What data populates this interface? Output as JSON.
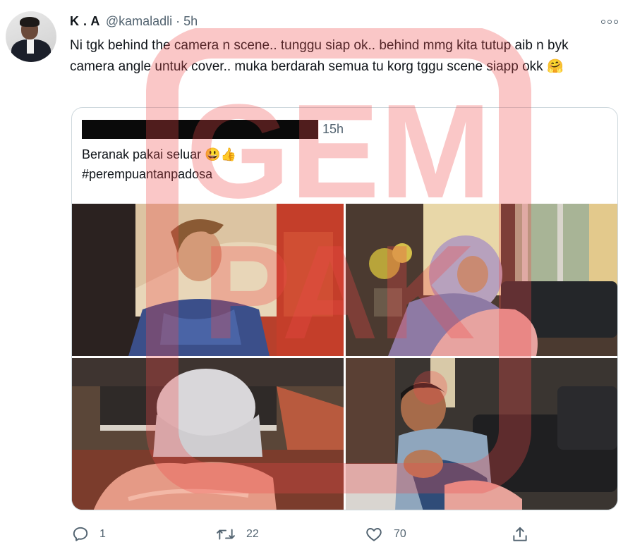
{
  "tweet": {
    "name": "K . A",
    "handle": "@kamaladli",
    "separator": "·",
    "time": "5h",
    "text": "Ni tgk behind the camera n scene.. tunggu siap ok.. behind mmg kita tutup aib n byk camera angle untuk cover.. muka berdarah semua tu korg tggu scene siapp okk 🤗"
  },
  "quote": {
    "time": "15h",
    "line1": "Beranak pakai seluar 😃👍",
    "line2": "#perempuantanpadosa",
    "photos": [
      "photo-1",
      "photo-2",
      "photo-3",
      "photo-4"
    ]
  },
  "actions": {
    "reply_count": "1",
    "retweet_count": "22",
    "like_count": "70"
  },
  "watermark": {
    "text": "GEMPAK",
    "color": "#f04a4a"
  },
  "icons": {
    "reply": "reply-icon",
    "retweet": "retweet-icon",
    "like": "heart-icon",
    "share": "share-icon",
    "more": "more-icon"
  }
}
